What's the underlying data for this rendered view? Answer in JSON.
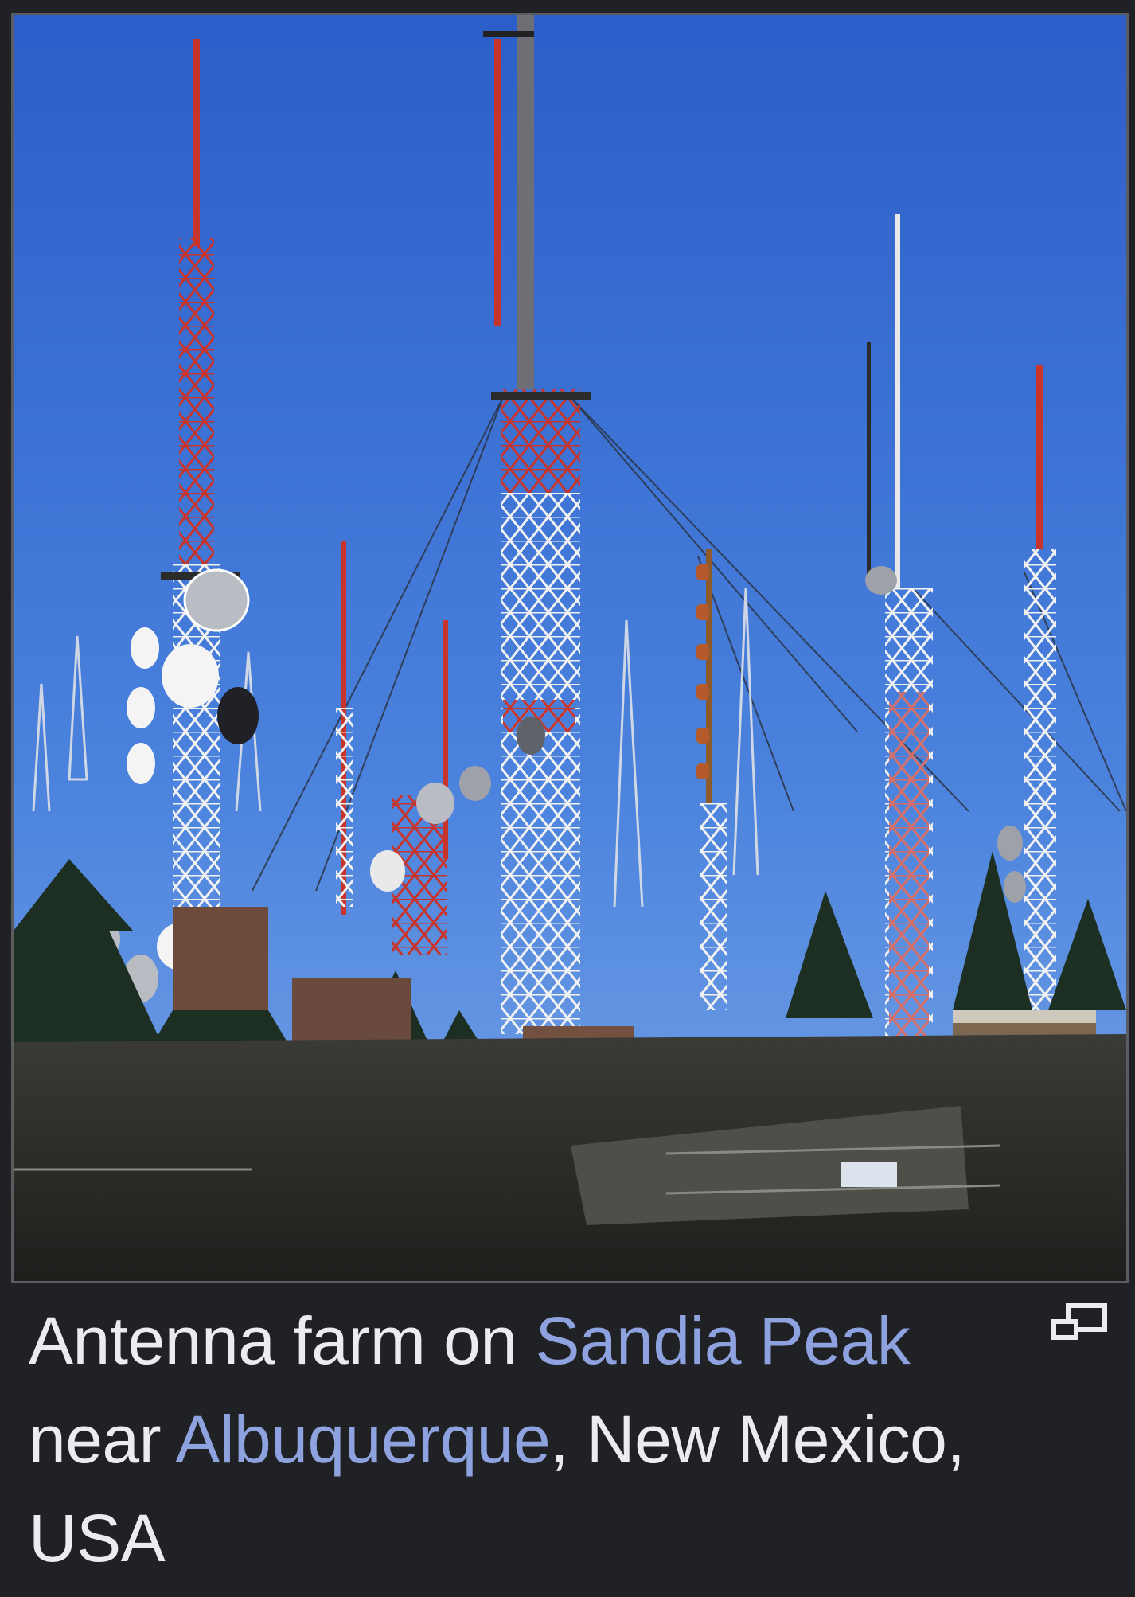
{
  "image": {
    "alt": "Antenna farm on Sandia Peak near Albuquerque, New Mexico, USA",
    "sky_top_color": "#2f62cc",
    "sky_bottom_color": "#6f9ce6"
  },
  "caption": {
    "part1": "Antenna farm on ",
    "link1": "Sandia Peak",
    "part2": " near ",
    "link2": "Albuquerque",
    "part3": ", New Mexico, USA"
  },
  "icons": {
    "enlarge": "magnify-clip-icon"
  },
  "colors": {
    "background": "#202124",
    "text": "#eaecf0",
    "link": "#8ea2e0",
    "frame_border": "#5a5c60"
  }
}
